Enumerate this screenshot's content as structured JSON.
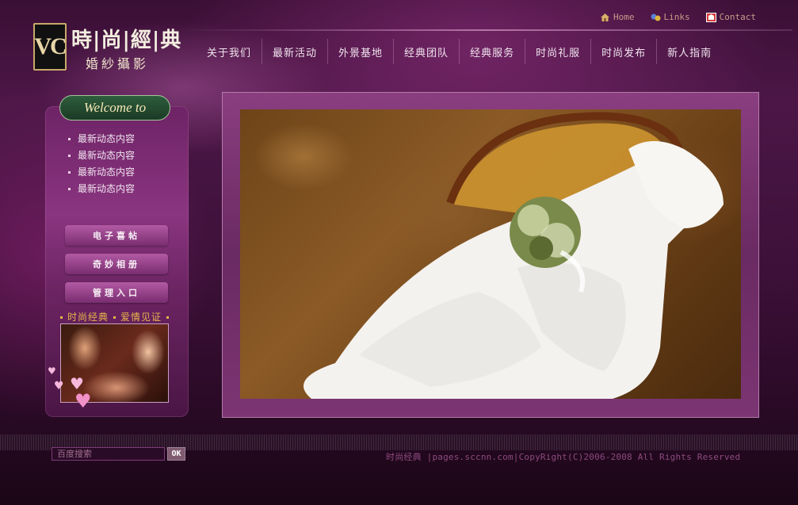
{
  "header": {
    "logo_text": "VC",
    "brand_title": "時|尚|經|典",
    "brand_sub": "婚紗攝影",
    "top_links": [
      {
        "label": "Home",
        "icon": "home-icon"
      },
      {
        "label": "Links",
        "icon": "links-icon"
      },
      {
        "label": "Contact",
        "icon": "contact-icon"
      }
    ],
    "nav": [
      "关于我们",
      "最新活动",
      "外景基地",
      "经典团队",
      "经典服务",
      "时尚礼服",
      "时尚发布",
      "新人指南"
    ]
  },
  "sidebar": {
    "welcome": "Welcome to",
    "news": [
      "最新动态内容",
      "最新动态内容",
      "最新动态内容",
      "最新动态内容"
    ],
    "buttons": [
      "电子喜帖",
      "奇妙相册",
      "管理入口"
    ],
    "tagline_left": "时尚经典",
    "tagline_right": "爱情见证"
  },
  "footer": {
    "search_placeholder": "百度搜索",
    "ok": "OK",
    "copyright": "时尚经典 |pages.sccnn.com|CopyRight(C)2006-2008 All Rights Reserved"
  },
  "colors": {
    "accent": "#e8b44a",
    "nav_text": "#f0e4ee",
    "frame": "#7a3370"
  }
}
